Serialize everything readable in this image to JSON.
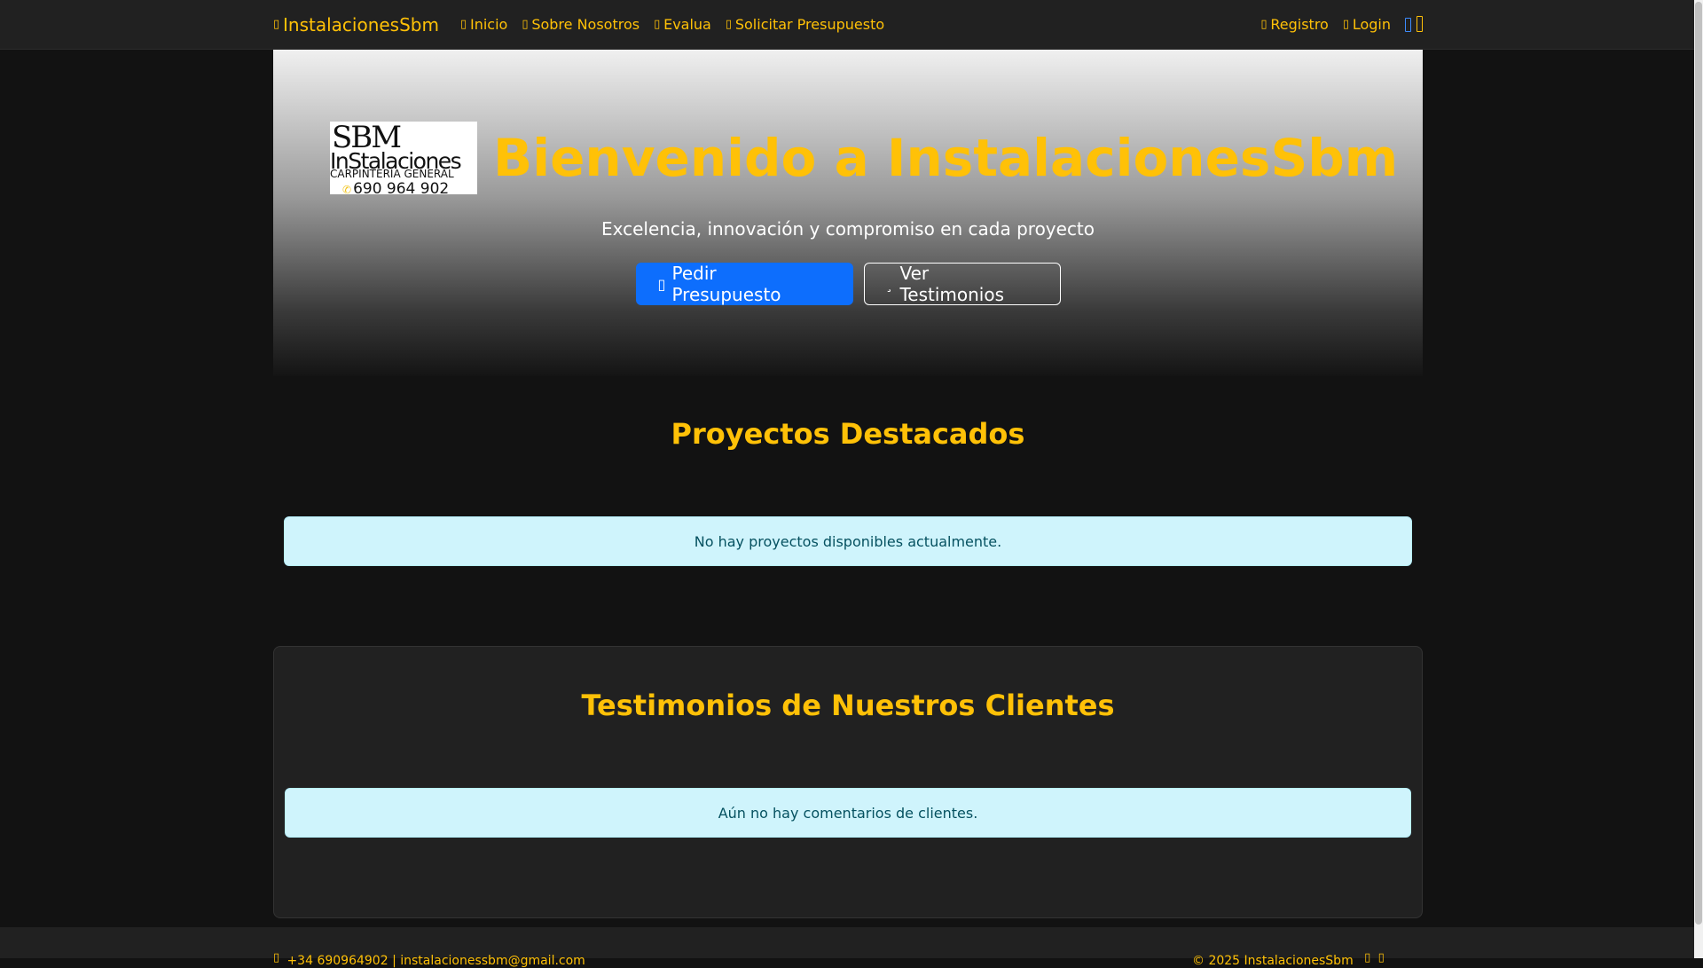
{
  "navbar": {
    "brand": "InstalacionesSbm",
    "links": [
      {
        "label": "Inicio"
      },
      {
        "label": "Sobre Nosotros"
      },
      {
        "label": "Evalua"
      },
      {
        "label": "Solicitar Presupuesto"
      }
    ],
    "right_links": [
      {
        "label": "Registro"
      },
      {
        "label": "Login"
      }
    ]
  },
  "hero": {
    "logo": {
      "line1": "SBM",
      "line2": "InStalaciones",
      "line3": "CARPINTERÍA GENERAL",
      "phone": "690 964 902"
    },
    "title": "Bienvenido a InstalacionesSbm",
    "subtitle": "Excelencia, innovación y compromiso en cada proyecto",
    "primary_button": "Pedir Presupuesto",
    "secondary_button": "Ver Testimonios"
  },
  "projects": {
    "title": "Proyectos Destacados",
    "empty_message": "No hay proyectos disponibles actualmente."
  },
  "testimonials": {
    "title": "Testimonios de Nuestros Clientes",
    "empty_message": "Aún no hay comentarios de clientes."
  },
  "footer": {
    "contact": "+34 690964902 | instalacionessbm@gmail.com",
    "copyright": "© 2025 InstalacionesSbm"
  },
  "colors": {
    "accent": "#ffc107",
    "primary": "#0d6efd",
    "info_bg": "#cff4fc",
    "info_text": "#055160",
    "background": "#121212",
    "navbar": "#212121"
  }
}
